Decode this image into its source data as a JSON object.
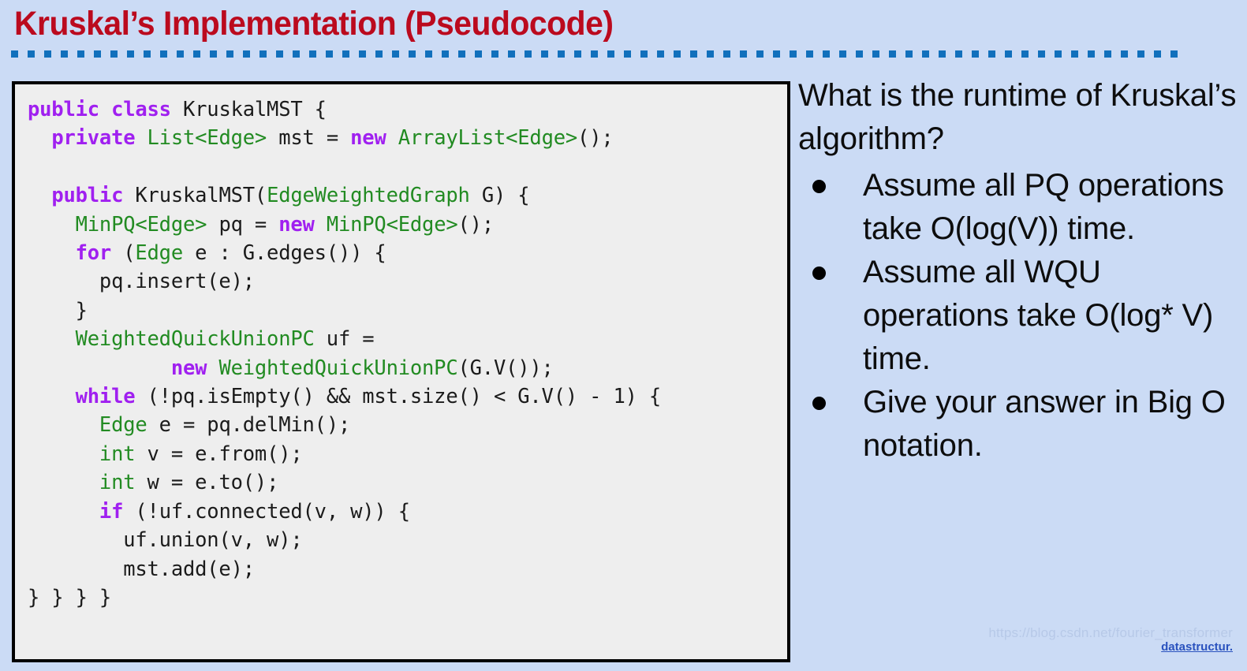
{
  "slide": {
    "title": "Kruskal’s Implementation (Pseudocode)",
    "background_color": "#cbdbf5",
    "title_color": "#bb0a1e",
    "rule_color": "#1170bc"
  },
  "code_panel": {
    "background_color": "#eeeeee",
    "border_color": "#000000",
    "keyword_color": "#a020f0",
    "type_color": "#228b22",
    "plain_color": "#1b1b1b",
    "lines": [
      [
        {
          "t": "public class ",
          "c": "kw"
        },
        {
          "t": "KruskalMST {",
          "c": "pln"
        }
      ],
      [
        {
          "t": "  ",
          "c": "pln"
        },
        {
          "t": "private ",
          "c": "kw"
        },
        {
          "t": "List<Edge>",
          "c": "typ"
        },
        {
          "t": " mst = ",
          "c": "pln"
        },
        {
          "t": "new ",
          "c": "kw"
        },
        {
          "t": "ArrayList<Edge>",
          "c": "typ"
        },
        {
          "t": "();",
          "c": "pln"
        }
      ],
      [
        {
          "t": "",
          "c": "pln"
        }
      ],
      [
        {
          "t": "  ",
          "c": "pln"
        },
        {
          "t": "public ",
          "c": "kw"
        },
        {
          "t": "KruskalMST(",
          "c": "pln"
        },
        {
          "t": "EdgeWeightedGraph",
          "c": "typ"
        },
        {
          "t": " G) {",
          "c": "pln"
        }
      ],
      [
        {
          "t": "    ",
          "c": "pln"
        },
        {
          "t": "MinPQ<Edge>",
          "c": "typ"
        },
        {
          "t": " pq = ",
          "c": "pln"
        },
        {
          "t": "new ",
          "c": "kw"
        },
        {
          "t": "MinPQ<Edge>",
          "c": "typ"
        },
        {
          "t": "();",
          "c": "pln"
        }
      ],
      [
        {
          "t": "    ",
          "c": "pln"
        },
        {
          "t": "for ",
          "c": "kw"
        },
        {
          "t": "(",
          "c": "pln"
        },
        {
          "t": "Edge",
          "c": "typ"
        },
        {
          "t": " e : G.edges()) {",
          "c": "pln"
        }
      ],
      [
        {
          "t": "      pq.insert(e);",
          "c": "pln"
        }
      ],
      [
        {
          "t": "    }",
          "c": "pln"
        }
      ],
      [
        {
          "t": "    ",
          "c": "pln"
        },
        {
          "t": "WeightedQuickUnionPC",
          "c": "typ"
        },
        {
          "t": " uf =",
          "c": "pln"
        }
      ],
      [
        {
          "t": "            ",
          "c": "pln"
        },
        {
          "t": "new ",
          "c": "kw"
        },
        {
          "t": "WeightedQuickUnionPC",
          "c": "typ"
        },
        {
          "t": "(G.V());",
          "c": "pln"
        }
      ],
      [
        {
          "t": "    ",
          "c": "pln"
        },
        {
          "t": "while ",
          "c": "kw"
        },
        {
          "t": "(!pq.isEmpty() && mst.size() < G.V() - 1) {",
          "c": "pln"
        }
      ],
      [
        {
          "t": "      ",
          "c": "pln"
        },
        {
          "t": "Edge",
          "c": "typ"
        },
        {
          "t": " e = pq.delMin();",
          "c": "pln"
        }
      ],
      [
        {
          "t": "      ",
          "c": "pln"
        },
        {
          "t": "int",
          "c": "typ"
        },
        {
          "t": " v = e.from();",
          "c": "pln"
        }
      ],
      [
        {
          "t": "      ",
          "c": "pln"
        },
        {
          "t": "int",
          "c": "typ"
        },
        {
          "t": " w = e.to();",
          "c": "pln"
        }
      ],
      [
        {
          "t": "      ",
          "c": "pln"
        },
        {
          "t": "if ",
          "c": "kw"
        },
        {
          "t": "(!uf.connected(v, w)) {",
          "c": "pln"
        }
      ],
      [
        {
          "t": "        uf.union(v, w);",
          "c": "pln"
        }
      ],
      [
        {
          "t": "        mst.add(e);",
          "c": "pln"
        }
      ],
      [
        {
          "t": "} } } }",
          "c": "pln"
        }
      ]
    ]
  },
  "right_panel": {
    "question": "What is the runtime of Kruskal’s algorithm?",
    "bullets": [
      "Assume all PQ operations take O(log(V)) time.",
      "Assume all WQU operations take O(log* V) time.",
      "Give your answer in Big O notation."
    ]
  },
  "watermark": {
    "url": "https://blog.csdn.net/fourier_transformer",
    "tag": "datastructur."
  }
}
